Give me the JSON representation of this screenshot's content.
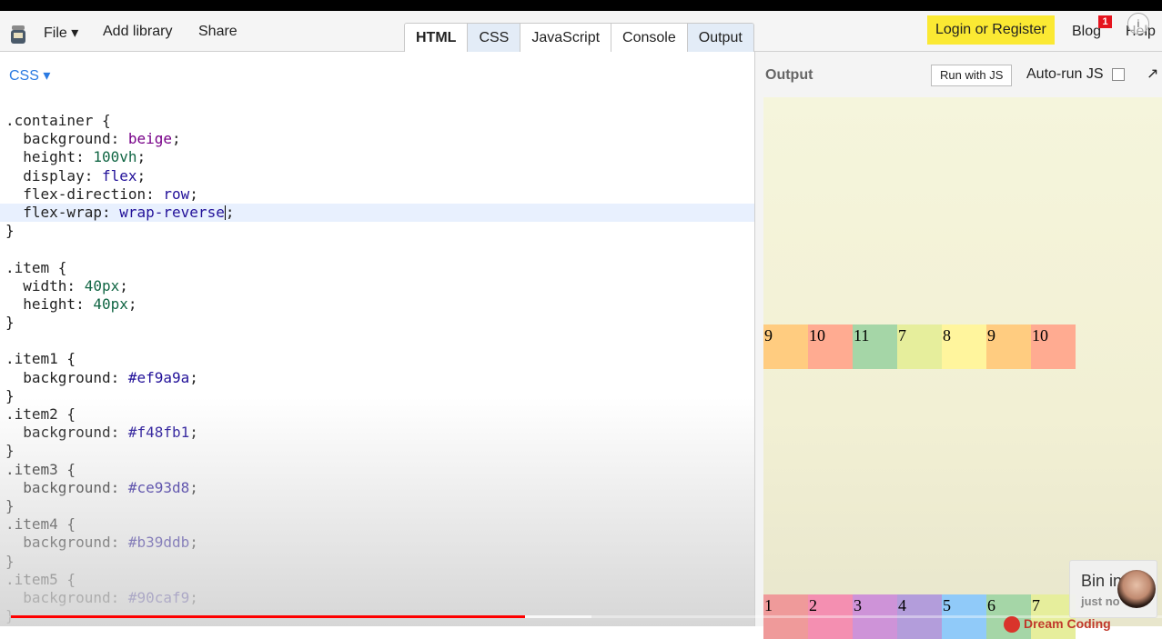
{
  "toolbar": {
    "file": "File ▾",
    "add_library": "Add library",
    "share": "Share",
    "tabs": [
      "HTML",
      "CSS",
      "JavaScript",
      "Console",
      "Output"
    ],
    "login": "Login or Register",
    "blog": "Blog",
    "blog_badge": "1",
    "help": "Help",
    "info": "i"
  },
  "editor": {
    "panel_title": "CSS ▾"
  },
  "output": {
    "title": "Output",
    "run_button": "Run with JS",
    "autorun_label": "Auto-run JS",
    "popout_icon": "↗",
    "top_row": [
      {
        "label": "9",
        "color": "#ffcc80"
      },
      {
        "label": "10",
        "color": "#ffab91"
      },
      {
        "label": "11",
        "color": "#a5d6a7"
      },
      {
        "label": "7",
        "color": "#e6ee9c"
      },
      {
        "label": "8",
        "color": "#fff59d"
      },
      {
        "label": "9",
        "color": "#ffcc80"
      },
      {
        "label": "10",
        "color": "#ffab91"
      }
    ],
    "bottom_row": [
      {
        "label": "1",
        "color": "#ef9a9a"
      },
      {
        "label": "2",
        "color": "#f48fb1"
      },
      {
        "label": "3",
        "color": "#ce93d8"
      },
      {
        "label": "4",
        "color": "#b39ddb"
      },
      {
        "label": "5",
        "color": "#90caf9"
      },
      {
        "label": "6",
        "color": "#a5d6a7"
      },
      {
        "label": "7",
        "color": "#e6ee9c"
      }
    ]
  },
  "toast": {
    "title": "Bin in",
    "subtitle": "just no"
  },
  "brand": "Dream Coding",
  "code_lines": [
    ".container {",
    "  background: beige;",
    "  height: 100vh;",
    "  display: flex;",
    "  flex-direction: row;",
    "  flex-wrap: wrap-reverse;",
    "}",
    "",
    ".item {",
    "  width: 40px;",
    "  height: 40px;",
    "}",
    "",
    ".item1 {",
    "  background: #ef9a9a;",
    "}",
    ".item2 {",
    "  background: #f48fb1;",
    "}",
    ".item3 {",
    "  background: #ce93d8;",
    "}",
    ".item4 {",
    "  background: #b39ddb;",
    "}",
    ".item5 {",
    "  background: #90caf9;",
    "}"
  ]
}
